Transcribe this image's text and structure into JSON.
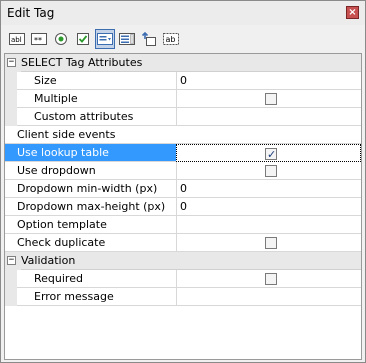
{
  "window": {
    "title": "Edit Tag",
    "close_label": "×"
  },
  "toolbar": {
    "buttons": [
      {
        "icon": "textbox-icon",
        "text": "abl"
      },
      {
        "icon": "password-icon",
        "text": "**"
      },
      {
        "icon": "radio-icon",
        "text": ""
      },
      {
        "icon": "checkbox-icon",
        "text": ""
      },
      {
        "icon": "select-icon",
        "text": ""
      },
      {
        "icon": "listbox-icon",
        "text": ""
      },
      {
        "icon": "upload-icon",
        "text": ""
      },
      {
        "icon": "label-icon",
        "text": "ab"
      }
    ]
  },
  "grid": {
    "rows": [
      {
        "type": "category",
        "label": "SELECT Tag Attributes",
        "toggle": "−"
      },
      {
        "type": "prop",
        "indent": true,
        "label": "Size",
        "value": "0"
      },
      {
        "type": "prop",
        "indent": true,
        "label": "Multiple",
        "checkbox": false
      },
      {
        "type": "prop",
        "indent": true,
        "label": "Custom attributes",
        "value": ""
      },
      {
        "type": "prop",
        "indent": false,
        "label": "Client side events",
        "value": "",
        "noval": true
      },
      {
        "type": "prop",
        "indent": false,
        "label": "Use lookup table",
        "checkbox": true,
        "selected": true
      },
      {
        "type": "prop",
        "indent": false,
        "label": "Use dropdown",
        "checkbox": false
      },
      {
        "type": "prop",
        "indent": false,
        "label": "Dropdown min-width (px)",
        "value": "0"
      },
      {
        "type": "prop",
        "indent": false,
        "label": "Dropdown max-height (px)",
        "value": "0"
      },
      {
        "type": "prop",
        "indent": false,
        "label": "Option template",
        "value": ""
      },
      {
        "type": "prop",
        "indent": false,
        "label": "Check duplicate",
        "checkbox": false
      },
      {
        "type": "category",
        "label": "Validation",
        "toggle": "−"
      },
      {
        "type": "prop",
        "indent": true,
        "label": "Required",
        "checkbox": false
      },
      {
        "type": "prop",
        "indent": true,
        "label": "Error message",
        "value": ""
      }
    ]
  },
  "colors": {
    "selection": "#3399ff",
    "category_bg": "#e8e8e8"
  }
}
